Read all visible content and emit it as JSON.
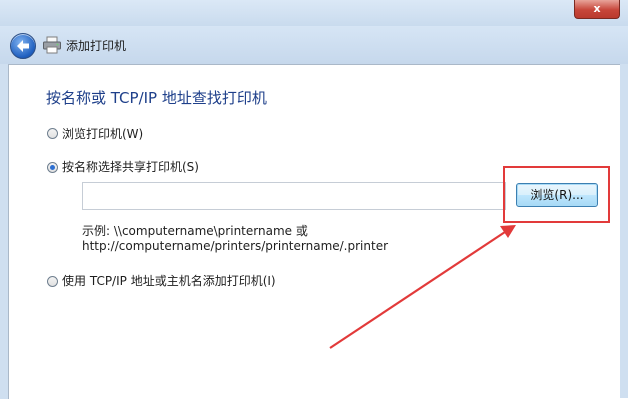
{
  "window": {
    "close_label": "x"
  },
  "nav": {
    "title": "添加打印机"
  },
  "heading": "按名称或 TCP/IP 地址查找打印机",
  "options": [
    {
      "label": "浏览打印机(W)",
      "checked": false
    },
    {
      "label": "按名称选择共享打印机(S)",
      "checked": true
    },
    {
      "label": "使用 TCP/IP 地址或主机名添加打印机(I)",
      "checked": false
    }
  ],
  "share_input": {
    "value": ""
  },
  "browse_button": {
    "label": "浏览(R)..."
  },
  "example": {
    "line1": "示例: \\\\computername\\printername 或",
    "line2": "http://computername/printers/printername/.printer"
  },
  "annotation_color": "#e23a3a"
}
